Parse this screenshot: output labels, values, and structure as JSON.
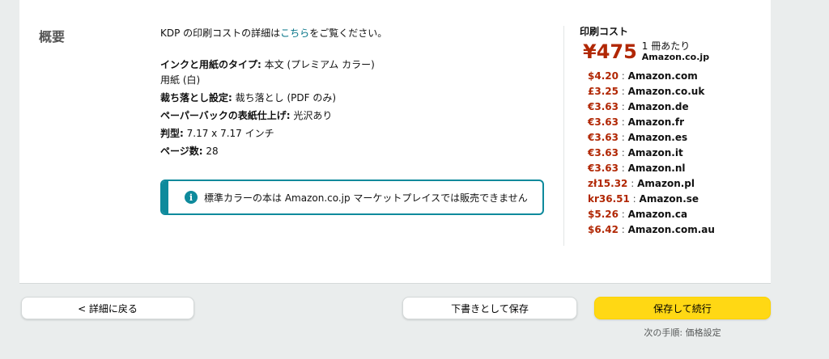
{
  "summary": {
    "title": "概要",
    "intro_prefix": "KDP の印刷コストの詳細は",
    "intro_link": "こちら",
    "intro_suffix": "をご覧ください。",
    "ink_label": "インクと用紙のタイプ:",
    "ink_value": " 本文 (プレミアム カラー)",
    "ink_value2": "用紙 (白)",
    "bleed_label": "裁ち落とし設定:",
    "bleed_value": " 裁ち落とし (PDF のみ)",
    "finish_label": "ペーパーバックの表紙仕上げ:",
    "finish_value": " 光沢あり",
    "trim_label": "判型:",
    "trim_value": " 7.17 x 7.17 インチ",
    "pages_label": "ページ数:",
    "pages_value": " 28",
    "alert_text": "標準カラーの本は Amazon.co.jp マーケットプレイスでは販売できません"
  },
  "print_cost": {
    "title": "印刷コスト",
    "main_amount": "¥475",
    "per_copy": "1 冊あたり",
    "main_market": "Amazon.co.jp",
    "separator": " : ",
    "markets": [
      {
        "price": "$4.20",
        "market": "Amazon.com"
      },
      {
        "price": "£3.25",
        "market": "Amazon.co.uk"
      },
      {
        "price": "€3.63",
        "market": "Amazon.de"
      },
      {
        "price": "€3.63",
        "market": "Amazon.fr"
      },
      {
        "price": "€3.63",
        "market": "Amazon.es"
      },
      {
        "price": "€3.63",
        "market": "Amazon.it"
      },
      {
        "price": "€3.63",
        "market": "Amazon.nl"
      },
      {
        "price": "zł15.32",
        "market": "Amazon.pl"
      },
      {
        "price": "kr36.51",
        "market": "Amazon.se"
      },
      {
        "price": "$5.26",
        "market": "Amazon.ca"
      },
      {
        "price": "$6.42",
        "market": "Amazon.com.au"
      }
    ]
  },
  "footer": {
    "back_label": "< 詳細に戻る",
    "draft_label": "下書きとして保存",
    "save_label": "保存して続行",
    "next_step": "次の手順: 価格設定"
  },
  "colors": {
    "accent": "#0e8a9c",
    "price": "#b12704",
    "primary_button": "#ffd814"
  },
  "icons": {
    "alert": "info-icon"
  }
}
